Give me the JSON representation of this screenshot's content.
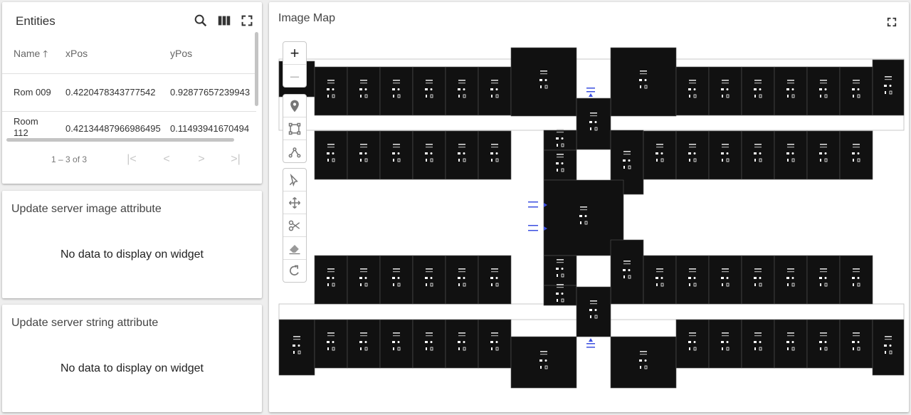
{
  "entities": {
    "title": "Entities",
    "columns": [
      {
        "label": "Name",
        "sorted": true
      },
      {
        "label": "xPos"
      },
      {
        "label": "yPos"
      }
    ],
    "rows": [
      {
        "name": "Rom 009",
        "xPos": "0.4220478343777542",
        "yPos": "0.92877657239943"
      },
      {
        "name": "Room 112",
        "xPos": "0.42134487966986495",
        "yPos": "0.11493941670494"
      }
    ],
    "pager": "1 – 3 of 3",
    "icons": [
      "search-icon",
      "columns-icon",
      "fullscreen-icon"
    ]
  },
  "image_attr_widget": {
    "title": "Update server image attribute",
    "message": "No data to display on widget"
  },
  "string_attr_widget": {
    "title": "Update server string attribute",
    "message": "No data to display on widget"
  },
  "image_map": {
    "title": "Image Map",
    "zoom_in": "+",
    "zoom_out": "–",
    "draw_tools": [
      "marker-icon",
      "rectangle-icon",
      "polyline-icon"
    ],
    "edit_tools": [
      "edit-icon",
      "move-icon",
      "cut-icon",
      "erase-icon",
      "rotate-icon"
    ],
    "colors": {
      "room": "#111111",
      "walkway": "#ffffff",
      "entrance_marker": "#3b4fe0"
    }
  }
}
